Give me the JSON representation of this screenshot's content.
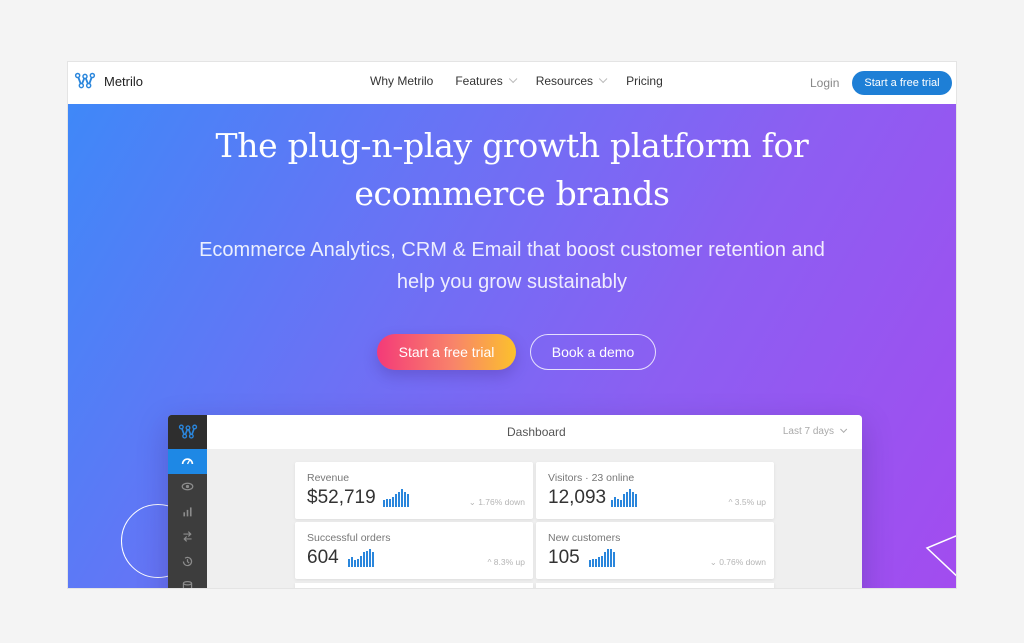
{
  "nav": {
    "brand": "Metrilo",
    "links": [
      {
        "label": "Why Metrilo",
        "dropdown": false
      },
      {
        "label": "Features",
        "dropdown": true
      },
      {
        "label": "Resources",
        "dropdown": true
      },
      {
        "label": "Pricing",
        "dropdown": false
      }
    ],
    "login": "Login",
    "cta": "Start a free trial",
    "cta_color": "#1e7fd6"
  },
  "hero": {
    "title_line1": "The plug-n-play growth platform for",
    "title_line2": "ecommerce brands",
    "subtitle_line1": "Ecommerce Analytics, CRM & Email that boost customer retention and",
    "subtitle_line2": "help you grow sustainably",
    "primary_button": "Start a free trial",
    "secondary_button": "Book a demo",
    "gradient_start": "#3f88f8",
    "gradient_end": "#a24cef"
  },
  "dashboard": {
    "title": "Dashboard",
    "range": "Last 7 days",
    "sidebar_icons": [
      "metrilo-logo-icon",
      "speedometer-icon",
      "eye-icon",
      "bar-chart-icon",
      "arrows-icon",
      "history-icon",
      "database-icon"
    ],
    "cards": [
      {
        "label": "Revenue",
        "value": "$52,719",
        "delta": "1.76% down",
        "direction": "down",
        "spark": [
          4,
          5,
          5,
          6,
          8,
          9,
          11,
          9,
          8
        ]
      },
      {
        "label": "Visitors · 23 online",
        "value": "12,093",
        "delta": "3.5% up",
        "direction": "up",
        "spark": [
          4,
          6,
          5,
          4,
          8,
          9,
          11,
          9,
          8
        ]
      },
      {
        "label": "Successful orders",
        "value": "604",
        "delta": "8.3% up",
        "direction": "up",
        "spark": [
          5,
          6,
          4,
          5,
          7,
          9,
          10,
          11,
          9
        ]
      },
      {
        "label": "New customers",
        "value": "105",
        "delta": "0.76% down",
        "direction": "down",
        "spark": [
          4,
          5,
          5,
          6,
          7,
          9,
          11,
          11,
          9
        ]
      }
    ]
  }
}
